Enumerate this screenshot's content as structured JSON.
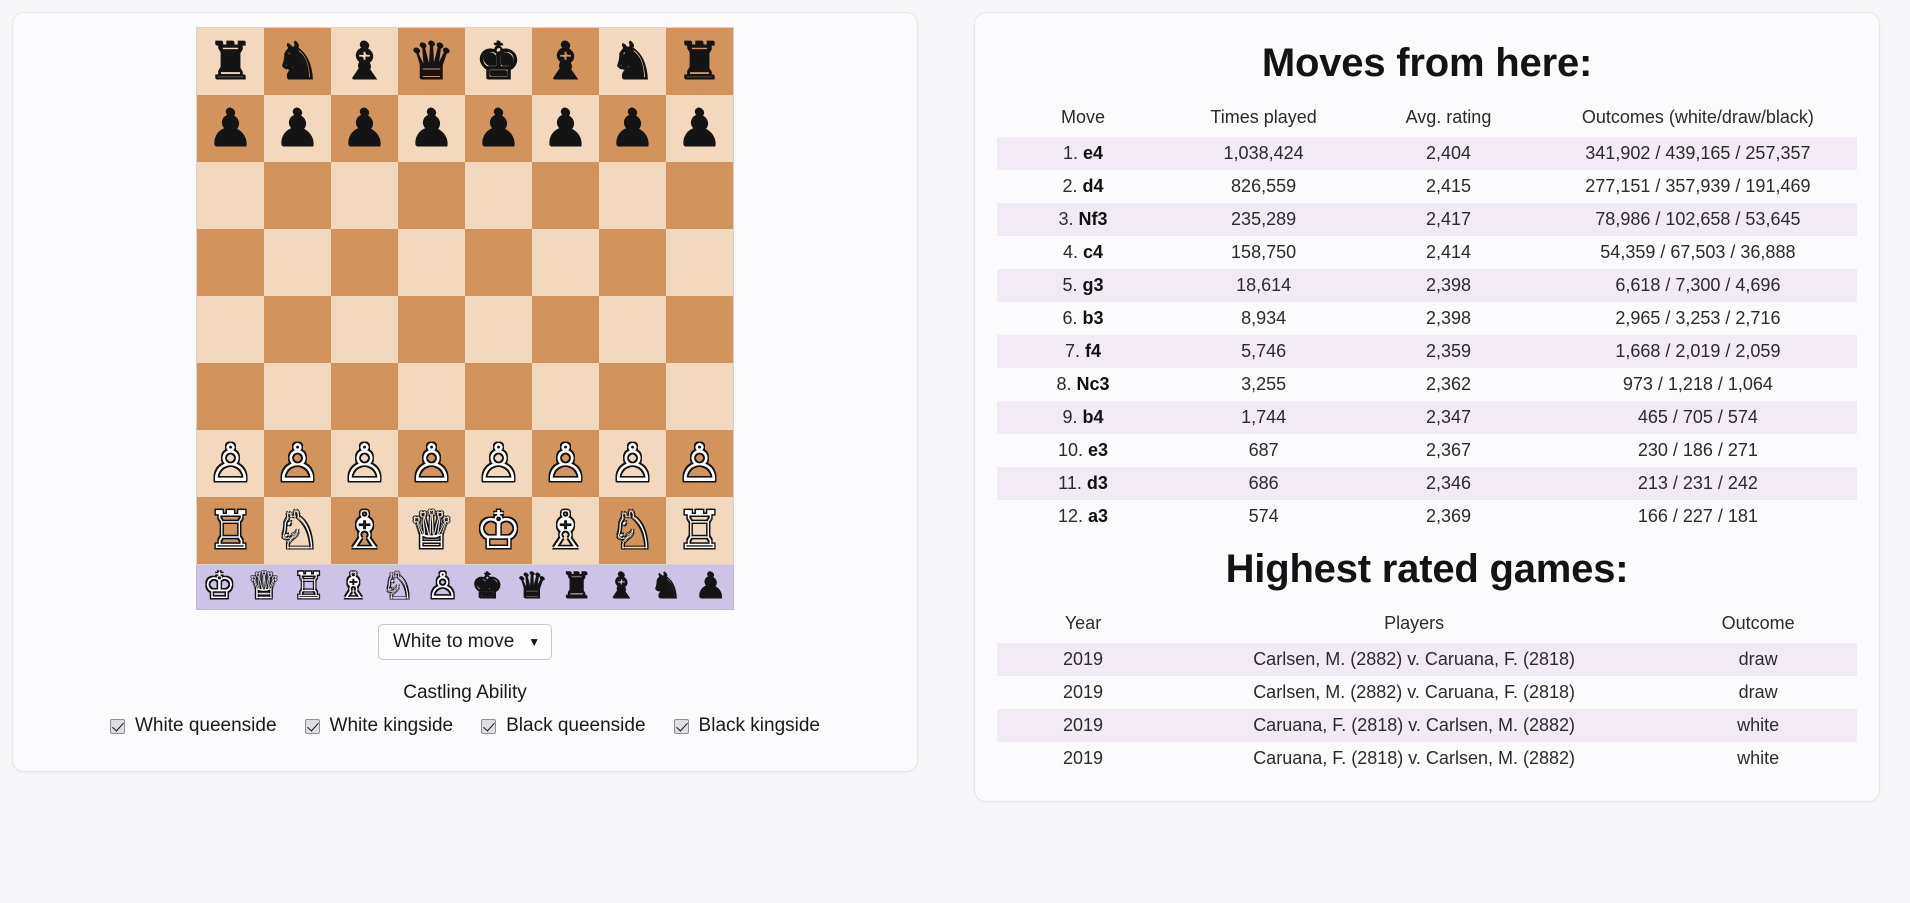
{
  "board": {
    "pieces": [
      [
        "bR",
        "bN",
        "bB",
        "bQ",
        "bK",
        "bB",
        "bN",
        "bR"
      ],
      [
        "bP",
        "bP",
        "bP",
        "bP",
        "bP",
        "bP",
        "bP",
        "bP"
      ],
      [
        "",
        "",
        "",
        "",
        "",
        "",
        "",
        ""
      ],
      [
        "",
        "",
        "",
        "",
        "",
        "",
        "",
        ""
      ],
      [
        "",
        "",
        "",
        "",
        "",
        "",
        "",
        ""
      ],
      [
        "",
        "",
        "",
        "",
        "",
        "",
        "",
        ""
      ],
      [
        "wP",
        "wP",
        "wP",
        "wP",
        "wP",
        "wP",
        "wP",
        "wP"
      ],
      [
        "wR",
        "wN",
        "wB",
        "wQ",
        "wK",
        "wB",
        "wN",
        "wR"
      ]
    ],
    "palette": [
      "wK",
      "wQ",
      "wR",
      "wB",
      "wN",
      "wP",
      "bK",
      "bQ",
      "bR",
      "bB",
      "bN",
      "bP"
    ],
    "light_color": "#f2d9bd",
    "dark_color": "#d2945c",
    "palette_color": "#cdc3e6"
  },
  "controls": {
    "to_move_label": "White to move",
    "to_move_caret": "▼",
    "castling_title": "Castling Ability",
    "castling": [
      {
        "label": "White queenside",
        "checked": true
      },
      {
        "label": "White kingside",
        "checked": true
      },
      {
        "label": "Black queenside",
        "checked": true
      },
      {
        "label": "Black kingside",
        "checked": true
      }
    ]
  },
  "moves_section": {
    "title": "Moves from here:",
    "headers": [
      "Move",
      "Times played",
      "Avg. rating",
      "Outcomes (white/draw/black)"
    ],
    "rows": [
      {
        "num": "1.",
        "san": "e4",
        "times": "1,038,424",
        "rating": "2,404",
        "outcomes": "341,902 / 439,165 / 257,357"
      },
      {
        "num": "2.",
        "san": "d4",
        "times": "826,559",
        "rating": "2,415",
        "outcomes": "277,151 / 357,939 / 191,469"
      },
      {
        "num": "3.",
        "san": "Nf3",
        "times": "235,289",
        "rating": "2,417",
        "outcomes": "78,986 / 102,658 / 53,645"
      },
      {
        "num": "4.",
        "san": "c4",
        "times": "158,750",
        "rating": "2,414",
        "outcomes": "54,359 / 67,503 / 36,888"
      },
      {
        "num": "5.",
        "san": "g3",
        "times": "18,614",
        "rating": "2,398",
        "outcomes": "6,618 / 7,300 / 4,696"
      },
      {
        "num": "6.",
        "san": "b3",
        "times": "8,934",
        "rating": "2,398",
        "outcomes": "2,965 / 3,253 / 2,716"
      },
      {
        "num": "7.",
        "san": "f4",
        "times": "5,746",
        "rating": "2,359",
        "outcomes": "1,668 / 2,019 / 2,059"
      },
      {
        "num": "8.",
        "san": "Nc3",
        "times": "3,255",
        "rating": "2,362",
        "outcomes": "973 / 1,218 / 1,064"
      },
      {
        "num": "9.",
        "san": "b4",
        "times": "1,744",
        "rating": "2,347",
        "outcomes": "465 / 705 / 574"
      },
      {
        "num": "10.",
        "san": "e3",
        "times": "687",
        "rating": "2,367",
        "outcomes": "230 / 186 / 271"
      },
      {
        "num": "11.",
        "san": "d3",
        "times": "686",
        "rating": "2,346",
        "outcomes": "213 / 231 / 242"
      },
      {
        "num": "12.",
        "san": "a3",
        "times": "574",
        "rating": "2,369",
        "outcomes": "166 / 227 / 181"
      }
    ]
  },
  "games_section": {
    "title": "Highest rated games:",
    "headers": [
      "Year",
      "Players",
      "Outcome"
    ],
    "rows": [
      {
        "year": "2019",
        "players": "Carlsen, M. (2882) v. Caruana, F. (2818)",
        "outcome": "draw"
      },
      {
        "year": "2019",
        "players": "Carlsen, M. (2882) v. Caruana, F. (2818)",
        "outcome": "draw"
      },
      {
        "year": "2019",
        "players": "Caruana, F. (2818) v. Carlsen, M. (2882)",
        "outcome": "white"
      },
      {
        "year": "2019",
        "players": "Caruana, F. (2818) v. Carlsen, M. (2882)",
        "outcome": "white"
      }
    ]
  }
}
